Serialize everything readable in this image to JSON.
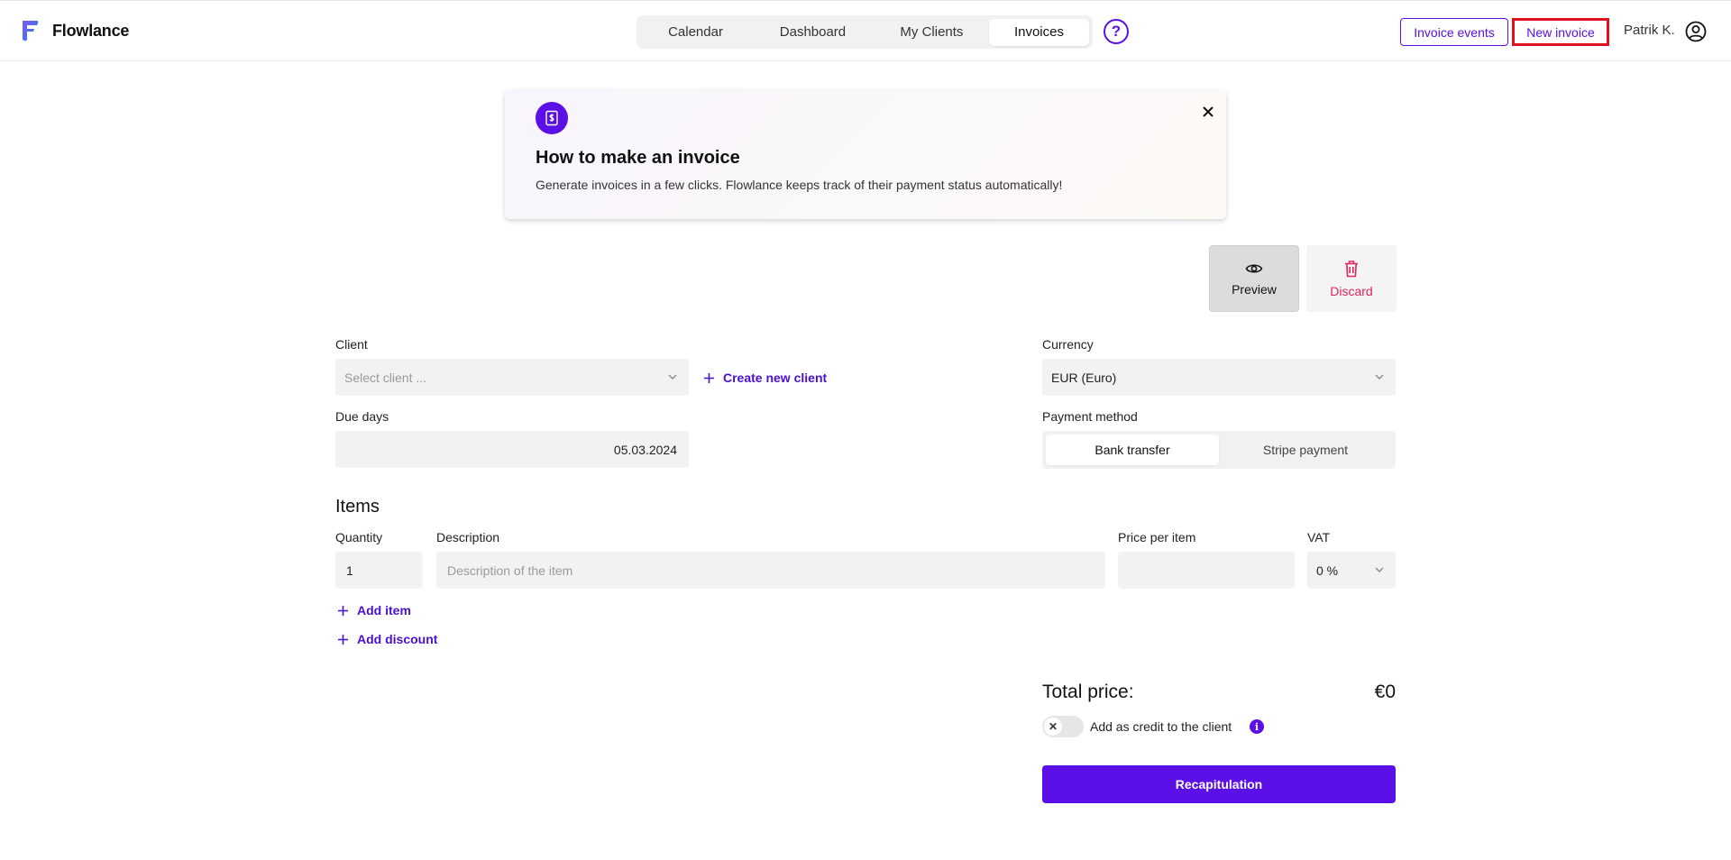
{
  "app": {
    "name": "Flowlance"
  },
  "nav": {
    "tabs": [
      {
        "label": "Calendar"
      },
      {
        "label": "Dashboard"
      },
      {
        "label": "My Clients"
      },
      {
        "label": "Invoices",
        "active": true
      }
    ],
    "help_label": "?"
  },
  "header": {
    "invoice_events_label": "Invoice events",
    "new_invoice_label": "New invoice",
    "user_name": "Patrik K."
  },
  "banner": {
    "title": "How to make an invoice",
    "text": "Generate invoices in a few clicks. Flowlance keeps track of their payment status automatically!"
  },
  "actions": {
    "preview_label": "Preview",
    "discard_label": "Discard"
  },
  "form": {
    "client_label": "Client",
    "client_placeholder": "Select client ...",
    "create_client_label": "Create new client",
    "currency_label": "Currency",
    "currency_value": "EUR (Euro)",
    "due_days_label": "Due days",
    "due_date_value": "05.03.2024",
    "payment_method_label": "Payment method",
    "payment_methods": [
      "Bank transfer",
      "Stripe payment"
    ],
    "selected_payment_method": "Bank transfer"
  },
  "items": {
    "title": "Items",
    "quantity_label": "Quantity",
    "description_label": "Description",
    "price_label": "Price per item",
    "vat_label": "VAT",
    "quantity_value": "1",
    "description_placeholder": "Description of the item",
    "price_value": "",
    "vat_value": "0 %",
    "add_item_label": "Add item",
    "add_discount_label": "Add discount"
  },
  "summary": {
    "total_label": "Total price:",
    "total_value": "€0",
    "credit_label": "Add as credit to the client",
    "credit_enabled": false,
    "toggle_symbol": "✕",
    "info_symbol": "i",
    "recap_label": "Recapitulation"
  },
  "colors": {
    "accent": "#5a10e6",
    "danger": "#e0245e",
    "highlight_border": "#e0101c"
  }
}
